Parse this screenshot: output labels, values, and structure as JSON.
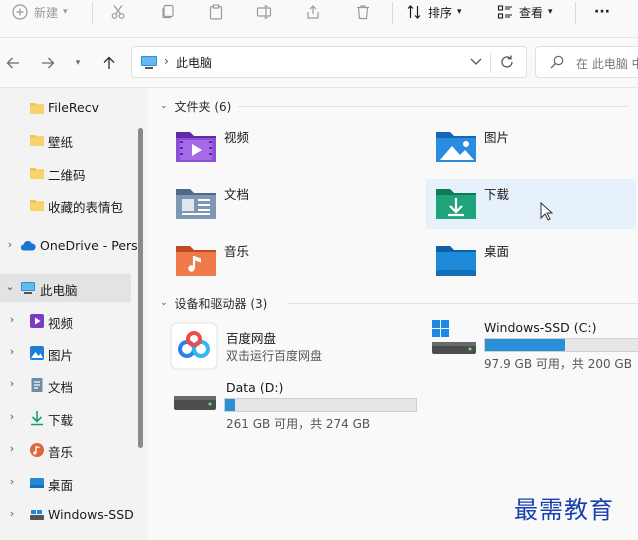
{
  "toolbar": {
    "new_label": "新建",
    "sort_label": "排序",
    "view_label": "查看",
    "more_label": "···"
  },
  "address": {
    "separator": "›",
    "crumb": "此电脑",
    "search_placeholder": "在 此电脑 中"
  },
  "sidebar": {
    "items": [
      {
        "label": "FileRecv",
        "icon": "folder-icon"
      },
      {
        "label": "壁纸",
        "icon": "folder-icon"
      },
      {
        "label": "二维码",
        "icon": "folder-icon"
      },
      {
        "label": "收藏的表情包",
        "icon": "folder-icon"
      },
      {
        "label": "OneDrive - Pers",
        "icon": "cloud-icon"
      },
      {
        "label": "此电脑",
        "icon": "pc-icon",
        "selected": true
      },
      {
        "label": "视频",
        "icon": "video-icon"
      },
      {
        "label": "图片",
        "icon": "picture-icon"
      },
      {
        "label": "文档",
        "icon": "document-icon"
      },
      {
        "label": "下载",
        "icon": "download-icon"
      },
      {
        "label": "音乐",
        "icon": "music-icon"
      },
      {
        "label": "桌面",
        "icon": "desktop-icon"
      },
      {
        "label": "Windows-SSD",
        "icon": "drive-icon"
      }
    ]
  },
  "folders_section": {
    "title": "文件夹 (6)",
    "items": [
      {
        "label": "视频",
        "icon": "video-folder-icon"
      },
      {
        "label": "图片",
        "icon": "pictures-folder-icon"
      },
      {
        "label": "文档",
        "icon": "documents-folder-icon"
      },
      {
        "label": "下载",
        "icon": "downloads-folder-icon"
      },
      {
        "label": "音乐",
        "icon": "music-folder-icon"
      },
      {
        "label": "桌面",
        "icon": "desktop-folder-icon"
      }
    ]
  },
  "devices_section": {
    "title": "设备和驱动器 (3)",
    "items": [
      {
        "label": "百度网盘",
        "sub": "双击运行百度网盘",
        "icon": "baidu-netdisk-icon"
      },
      {
        "label": "Windows-SSD (C:)",
        "sub": "97.9 GB 可用，共 200 GB",
        "used_fraction": 0.51,
        "icon": "windows-drive-icon"
      },
      {
        "label": "Data (D:)",
        "sub": "261 GB 可用，共 274 GB",
        "used_fraction": 0.05,
        "icon": "drive-icon"
      }
    ]
  },
  "watermark": "最需教育",
  "colors": {
    "accent": "#2b8fd8",
    "hover": "#e6f1fb",
    "selected": "#e3e3e3",
    "folder_yellow": "#f2c04e",
    "watermark": "#1a3fb0"
  }
}
